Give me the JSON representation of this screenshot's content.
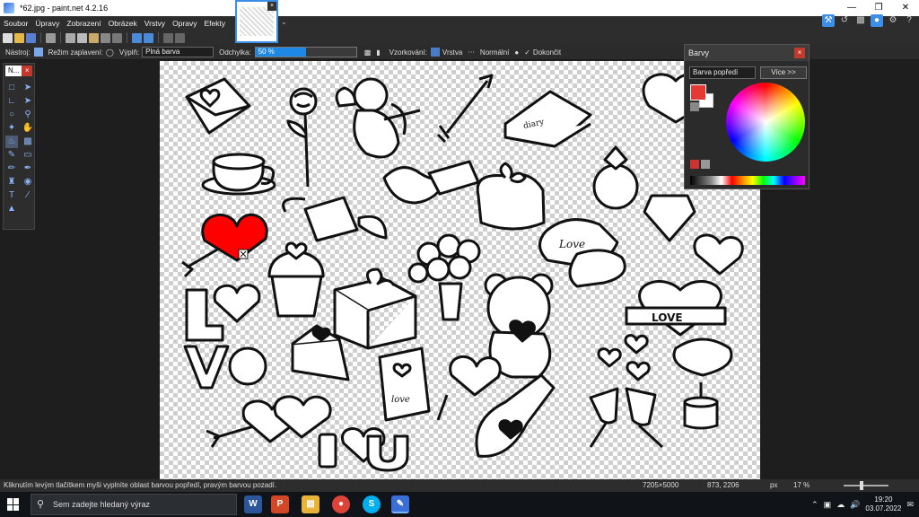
{
  "window": {
    "title": "*62.jpg - paint.net 4.2.16"
  },
  "menu": {
    "items": [
      "Soubor",
      "Úpravy",
      "Zobrazení",
      "Obrázek",
      "Vrstvy",
      "Opravy",
      "Efekty"
    ]
  },
  "toolbar": {
    "tool_label": "Nástroj:",
    "fill_mode_label": "Režim zaplavení:",
    "fill_label": "Výplň:",
    "fill_value": "Plná barva",
    "tolerance_label": "Odchylka:",
    "tolerance_value": "50 %",
    "tolerance_fraction": 0.5,
    "sampling_label": "Vzorkování:",
    "sampling_value": "Vrstva",
    "blend_value": "Normální",
    "finish_label": "Dokončit"
  },
  "tools_window": {
    "title": "N..."
  },
  "colors_window": {
    "title": "Barvy",
    "mode": "Barva popředí",
    "more_button": "Více >>",
    "primary_color": "#e53935",
    "secondary_color": "#ffffff"
  },
  "status": {
    "message": "Kliknutím levým tlačítkem myši vyplníte oblast barvou popředí, pravým barvou pozadí.",
    "image_size": "7205×5000",
    "cursor_pos": "873, 2206",
    "unit": "px",
    "zoom": "17 %"
  },
  "taskbar": {
    "search_placeholder": "Sem zadejte hledaný výraz",
    "time": "19:20",
    "date": "03.07.2022"
  },
  "canvas": {
    "heart_fill_color": "#ff0000",
    "texts": [
      "Love",
      "LOVE",
      "love",
      "diary",
      "I",
      "U"
    ]
  }
}
